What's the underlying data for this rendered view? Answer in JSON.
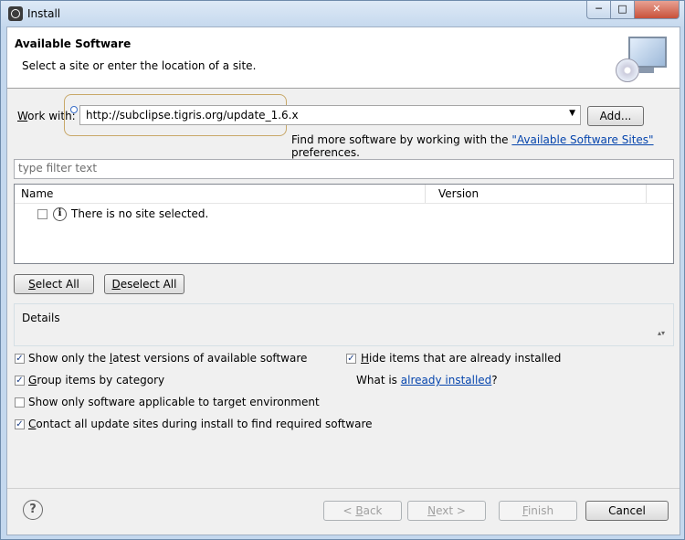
{
  "window": {
    "title": "Install",
    "minimize": "─",
    "maximize": "□",
    "close": "✕"
  },
  "banner": {
    "title": "Available Software",
    "description": "Select a site or enter the location of a site.",
    "icon": "monitor-cd-icon"
  },
  "work_with": {
    "label_prefix": "W",
    "label_rest": "ork with:",
    "value": "http://subclipse.tigris.org/update_1.6.x",
    "add_button": "Add..."
  },
  "find_more": {
    "prefix": "Find more software by working with the ",
    "link": "\"Available Software Sites\"",
    "suffix": " preferences."
  },
  "filter": {
    "placeholder": "type filter text"
  },
  "table": {
    "col_name": "Name",
    "col_version": "Version",
    "rows": [
      {
        "label": "There is no site selected.",
        "checked": false
      }
    ]
  },
  "buttons": {
    "select_all_u": "S",
    "select_all_rest": "elect All",
    "deselect_all_u": "D",
    "deselect_all_rest": "eselect All"
  },
  "details": {
    "label": "Details",
    "scroll_glyph": "▴▾"
  },
  "options": {
    "latest_u": "",
    "latest_pre": "Show only the ",
    "latest_ul": "l",
    "latest_post": "atest versions of available software",
    "group_ul": "G",
    "group_rest": "roup items by category",
    "applicable": "Show only software applicable to target environment",
    "contact_ul": "C",
    "contact_rest": "ontact all update sites during install to find required software",
    "hide_ul": "H",
    "hide_rest": "ide items that are already installed",
    "what_is": "What is ",
    "already_installed": "already installed",
    "question": "?"
  },
  "footer": {
    "help": "?",
    "back_pre": "< ",
    "back_ul": "B",
    "back_rest": "ack",
    "next_ul": "N",
    "next_rest": "ext >",
    "finish_ul": "F",
    "finish_rest": "inish",
    "cancel": "Cancel"
  },
  "colors": {
    "link": "#0645ad",
    "frame": "#c4d8ee"
  }
}
